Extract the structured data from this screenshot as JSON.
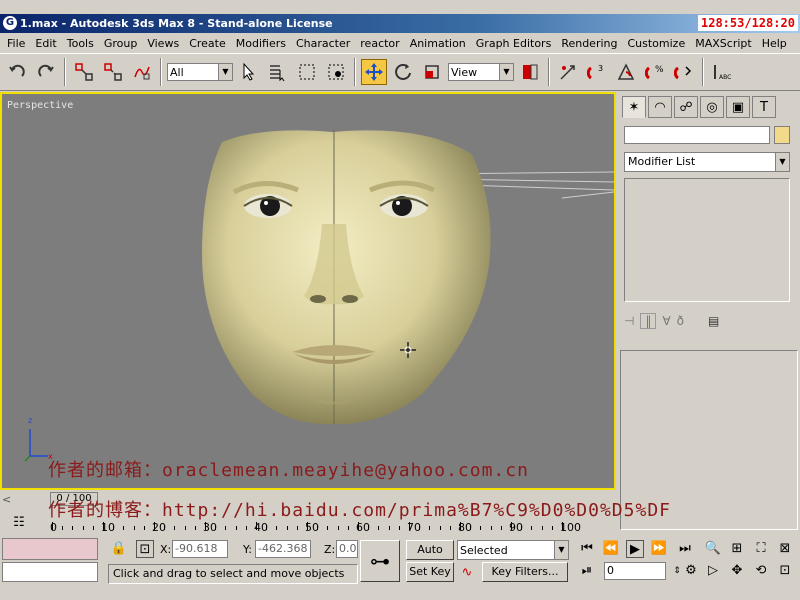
{
  "window": {
    "title": "1.max - Autodesk 3ds Max 8  - Stand-alone License",
    "timer": "128:53/128:20"
  },
  "menu": [
    "File",
    "Edit",
    "Tools",
    "Group",
    "Views",
    "Create",
    "Modifiers",
    "Character",
    "reactor",
    "Animation",
    "Graph Editors",
    "Rendering",
    "Customize",
    "MAXScript",
    "Help"
  ],
  "toolbar": {
    "selection_filter": "All",
    "reference_coord": "View"
  },
  "viewport": {
    "label": "Perspective",
    "axis_z": "z",
    "axis_x": "x",
    "watermark_email": "作者的邮箱：oraclemean.meayihe@yahoo.com.cn",
    "watermark_blog": "作者的博客：http://hi.baidu.com/prima%B7%C9%D0%D0%D5%DF"
  },
  "command_panel": {
    "modifier_list": "Modifier List"
  },
  "timeline": {
    "slider_label": "0 / 100",
    "ticks": [
      "0",
      "10",
      "20",
      "30",
      "40",
      "50",
      "60",
      "70",
      "80",
      "90",
      "100"
    ]
  },
  "status": {
    "x_label": "X:",
    "x_value": "-90.618",
    "y_label": "Y:",
    "y_value": "-462.368",
    "z_label": "Z:",
    "z_value": "0.0",
    "prompt": "Click and drag to select and move objects",
    "auto_key": "Auto Key",
    "set_key": "Set Key",
    "key_mode": "Selected",
    "key_filters": "Key Filters...",
    "frame": "0"
  }
}
